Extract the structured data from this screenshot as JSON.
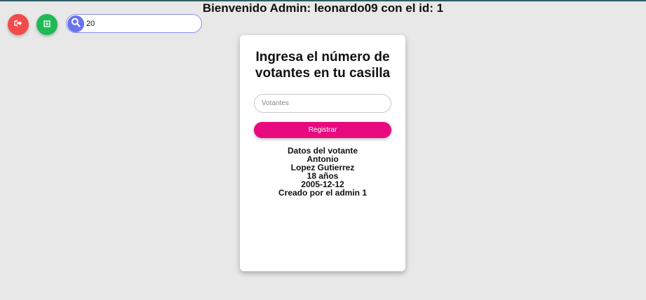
{
  "header": {
    "welcome_text": "Bienvenido Admin: leonardo09 con el id: 1"
  },
  "toolbar": {
    "logout_icon": "logout-icon",
    "report_icon": "report-icon",
    "search_icon": "search-icon",
    "search_value": "20",
    "colors": {
      "logout": "#f24b4b",
      "report": "#1fb955",
      "search": "#6a73f0"
    }
  },
  "card": {
    "title": "Ingresa el número de votantes en tu casilla",
    "votantes_placeholder": "Votantes",
    "votantes_value": "",
    "register_label": "Registrar",
    "register_color": "#e8097f"
  },
  "voter": {
    "heading": "Datos del votante",
    "first_name": "Antonio",
    "last_name": "Lopez Gutierrez",
    "age": "18 años",
    "birth_date": "2005-12-12",
    "created_by": "Creado por el admin 1"
  }
}
